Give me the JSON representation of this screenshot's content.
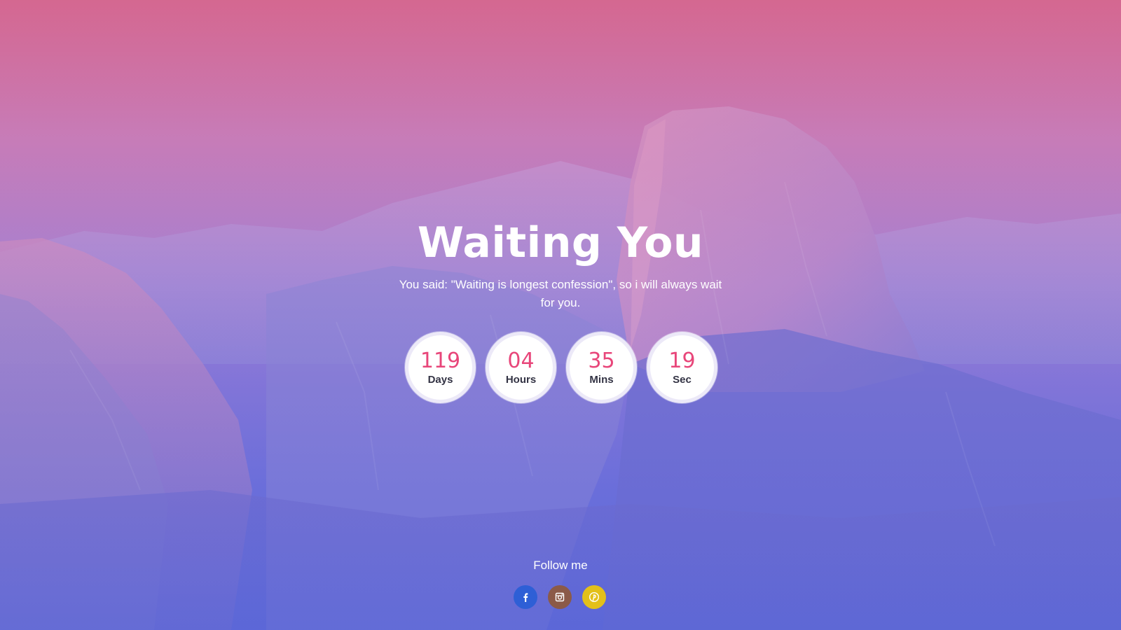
{
  "page": {
    "title": "Waiting You",
    "subtitle": "You said: \"Waiting is longest confession\", so i will always wait for you."
  },
  "countdown": [
    {
      "value": "119",
      "unit": "Days"
    },
    {
      "value": "04",
      "unit": "Hours"
    },
    {
      "value": "35",
      "unit": "Mins"
    },
    {
      "value": "19",
      "unit": "Sec"
    }
  ],
  "footer": {
    "follow_label": "Follow me",
    "social": [
      {
        "icon": "facebook-icon",
        "color": "#2e5fd6"
      },
      {
        "icon": "instagram-icon",
        "color": "#8b5a48"
      },
      {
        "icon": "pinterest-icon",
        "color": "#e3c019"
      }
    ]
  },
  "colors": {
    "accent_number": "#e8467a",
    "unit_text": "#333344"
  }
}
